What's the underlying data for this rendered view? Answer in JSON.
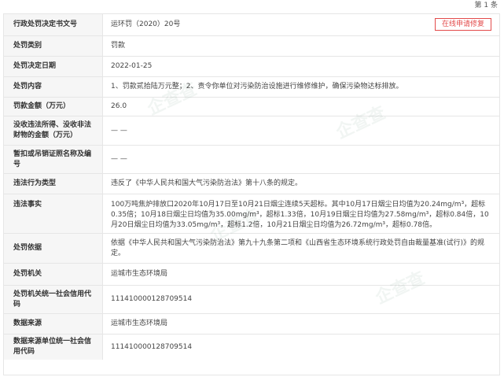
{
  "header": {
    "record_count": "第 1 条"
  },
  "repair_button": "在线申请修复",
  "rows": [
    {
      "label": "行政处罚决定书文号",
      "value": "运环罚（2020）20号"
    },
    {
      "label": "处罚类别",
      "value": "罚款"
    },
    {
      "label": "处罚决定日期",
      "value": "2022-01-25"
    },
    {
      "label": "处罚内容",
      "value": "1、罚款贰拾陆万元整；2、责令你单位对污染防治设施进行维修维护，确保污染物达标排放。"
    },
    {
      "label": "罚款金额（万元）",
      "value": "26.0"
    },
    {
      "label": "没收违法所得、没收非法财物的金额（万元）",
      "value": "— —"
    },
    {
      "label": "暂扣或吊销证照名称及编号",
      "value": "— —"
    },
    {
      "label": "违法行为类型",
      "value": "违反了《中华人民共和国大气污染防治法》第十八条的规定。"
    },
    {
      "label": "违法事实",
      "value": "100万吨焦炉排放口2020年10月17日至10月21日烟尘连续5天超标。其中10月17日烟尘日均值为20.24mg/m³，超标0.35倍；10月18日烟尘日均值为35.00mg/m³，超标1.33倍，10月19日烟尘日均值为27.58mg/m³，超标0.84倍，10月20日烟尘日均值为33.05mg/m³，超标1.2倍，10月21日烟尘日均值为26.72mg/m³，超标0.78倍。"
    },
    {
      "label": "处罚依据",
      "value": "依据《中华人民共和国大气污染防治法》第九十九条第二项和《山西省生态环境系统行政处罚自由裁量基准(试行)》的规定。"
    },
    {
      "label": "处罚机关",
      "value": "运城市生态环境局"
    },
    {
      "label": "处罚机关统一社会信用代码",
      "value": "111410000128709514"
    },
    {
      "label": "数据来源",
      "value": "运城市生态环境局"
    },
    {
      "label": "数据来源单位统一社会信用代码",
      "value": "111410000128709514"
    }
  ]
}
